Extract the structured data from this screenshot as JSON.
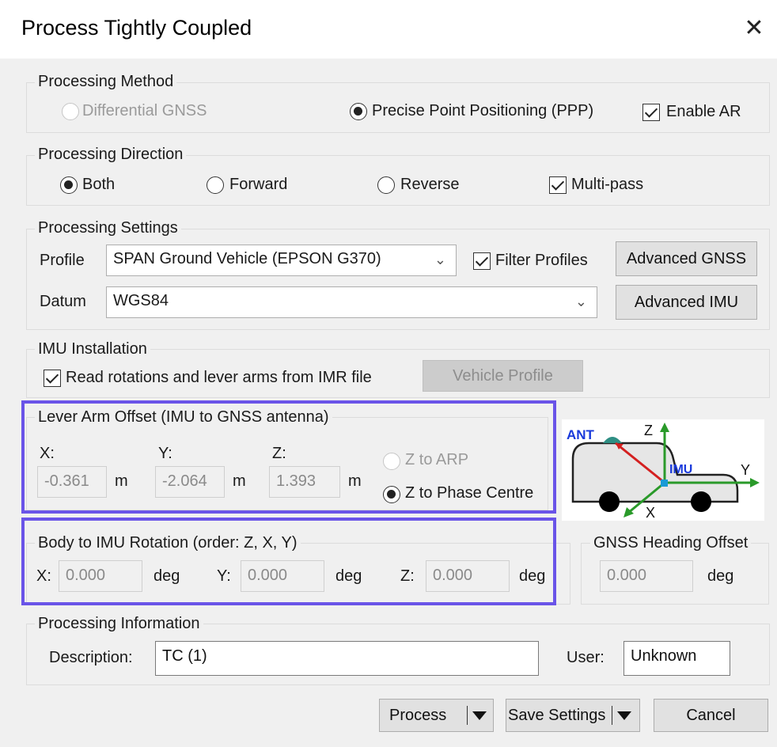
{
  "window": {
    "title": "Process Tightly Coupled",
    "close": "✕"
  },
  "processing_method": {
    "legend": "Processing Method",
    "differential_gnss": "Differential GNSS",
    "ppp": "Precise Point Positioning (PPP)",
    "enable_ar": "Enable AR"
  },
  "processing_direction": {
    "legend": "Processing Direction",
    "both": "Both",
    "forward": "Forward",
    "reverse": "Reverse",
    "multipass": "Multi-pass"
  },
  "processing_settings": {
    "legend": "Processing Settings",
    "profile_label": "Profile",
    "profile_value": "SPAN Ground Vehicle (EPSON G370)",
    "filter_profiles": "Filter Profiles",
    "advanced_gnss": "Advanced GNSS",
    "datum_label": "Datum",
    "datum_value": "WGS84",
    "advanced_imu": "Advanced IMU"
  },
  "imu_installation": {
    "legend": "IMU Installation",
    "read_rotations": "Read rotations and lever arms from IMR file",
    "vehicle_profile": "Vehicle Profile"
  },
  "lever_arm": {
    "legend": "Lever Arm Offset (IMU to GNSS antenna)",
    "x_label": "X:",
    "x_value": "-0.361",
    "x_unit": "m",
    "y_label": "Y:",
    "y_value": "-2.064",
    "y_unit": "m",
    "z_label": "Z:",
    "z_value": "1.393",
    "z_unit": "m",
    "z_to_arp": "Z to ARP",
    "z_to_phase": "Z to Phase Centre"
  },
  "diagram": {
    "ant": "ANT",
    "imu": "IMU",
    "x": "X",
    "y": "Y",
    "z": "Z"
  },
  "body_rotation": {
    "legend": "Body to IMU Rotation (order: Z, X, Y)",
    "x_label": "X:",
    "x_value": "0.000",
    "x_unit": "deg",
    "y_label": "Y:",
    "y_value": "0.000",
    "y_unit": "deg",
    "z_label": "Z:",
    "z_value": "0.000",
    "z_unit": "deg"
  },
  "heading_offset": {
    "legend": "GNSS Heading Offset",
    "value": "0.000",
    "unit": "deg"
  },
  "processing_info": {
    "legend": "Processing Information",
    "description_label": "Description:",
    "description_value": "TC (1)",
    "user_label": "User:",
    "user_value": "Unknown"
  },
  "buttons": {
    "process": "Process",
    "save_settings": "Save Settings",
    "cancel": "Cancel"
  },
  "colors": {
    "highlight": "#6a54e8",
    "axis_green": "#2a9a2a",
    "lever_red": "#d42020",
    "ant_blue": "#1a3adb"
  }
}
